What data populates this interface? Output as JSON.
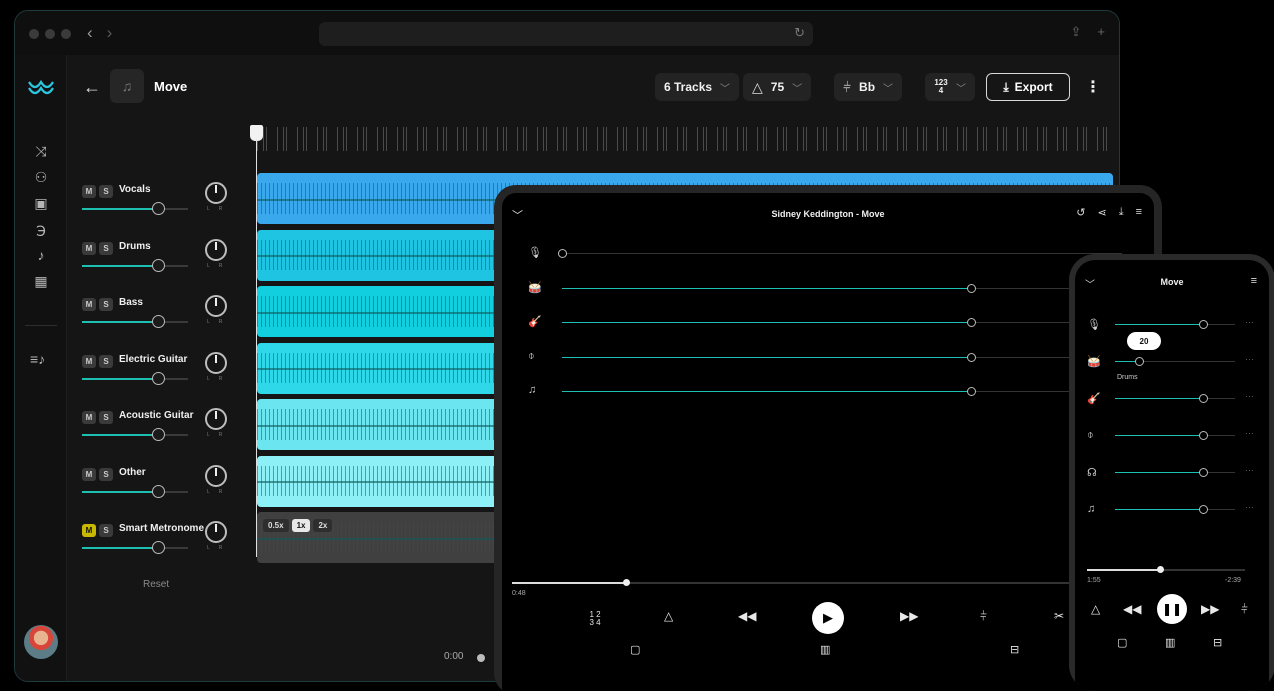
{
  "desktop": {
    "song_title": "Move",
    "tracks_pill": "6 Tracks",
    "tempo": "75",
    "key": "Bb",
    "time_sig": "1234",
    "export_label": "Export",
    "reset_label": "Reset",
    "current_time": "0:00",
    "speed_options": [
      "0.5x",
      "1x",
      "2x"
    ],
    "speed_selected": "1x",
    "tracks": [
      {
        "name": "Vocals",
        "volume": 0.72,
        "color": "#3aa8ec",
        "mute": false
      },
      {
        "name": "Drums",
        "volume": 0.72,
        "color": "#1ec4e2",
        "mute": false
      },
      {
        "name": "Bass",
        "volume": 0.72,
        "color": "#12cfe0",
        "mute": false
      },
      {
        "name": "Electric Guitar",
        "volume": 0.72,
        "color": "#2ed8e8",
        "mute": false
      },
      {
        "name": "Acoustic Guitar",
        "volume": 0.72,
        "color": "#6be6f0",
        "mute": false
      },
      {
        "name": "Other",
        "volume": 0.72,
        "color": "#8df0f6",
        "mute": false
      },
      {
        "name": "Smart Metronome",
        "volume": 0.72,
        "color": "#404040",
        "mute": true
      }
    ]
  },
  "tablet": {
    "title": "Sidney Keddington - Move",
    "elapsed": "0:48",
    "progress": 0.19,
    "rows": [
      {
        "icon": "microphone-icon",
        "glyph": "🎙",
        "level": 0.0
      },
      {
        "icon": "drum-icon",
        "glyph": "🥁",
        "level": 0.73
      },
      {
        "icon": "guitar-icon",
        "glyph": "🎸",
        "level": 0.73
      },
      {
        "icon": "bass-icon",
        "glyph": "⌽",
        "level": 0.73
      },
      {
        "icon": "note-icon",
        "glyph": "♫",
        "level": 0.73
      }
    ]
  },
  "phone": {
    "title": "Move",
    "tooltip": "20",
    "active_label": "Drums",
    "elapsed": "1:55",
    "remaining": "-2:39",
    "progress": 0.46,
    "rows": [
      {
        "icon": "microphone-icon",
        "glyph": "🎙",
        "level": 0.73
      },
      {
        "icon": "drum-icon",
        "glyph": "🥁",
        "level": 0.2
      },
      {
        "icon": "guitar-icon",
        "glyph": "🎸",
        "level": 0.73
      },
      {
        "icon": "bass-icon",
        "glyph": "⌽",
        "level": 0.73
      },
      {
        "icon": "piano-icon",
        "glyph": "☊",
        "level": 0.73
      },
      {
        "icon": "note-icon",
        "glyph": "♫",
        "level": 0.73
      }
    ]
  },
  "colors": {
    "accent": "#1dbfb0",
    "background": "#000000"
  }
}
